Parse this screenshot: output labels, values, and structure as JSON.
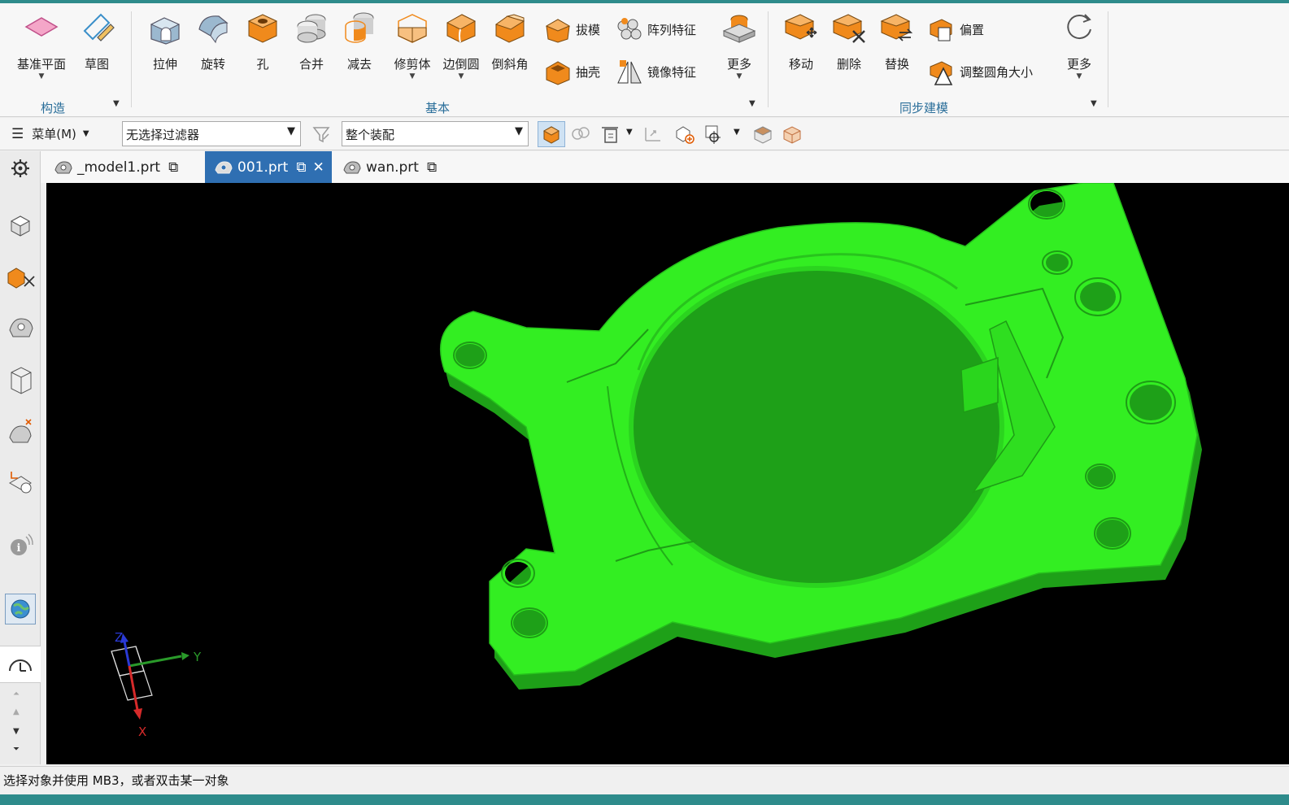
{
  "ribbon": {
    "construct": {
      "group_label": "构造",
      "tools": [
        {
          "label": "基准平面",
          "icon": "datum-plane-icon"
        },
        {
          "label": "草图",
          "icon": "sketch-icon"
        }
      ]
    },
    "basic": {
      "group_label": "基本",
      "tools": [
        {
          "label": "拉伸",
          "icon": "extrude-icon"
        },
        {
          "label": "旋转",
          "icon": "revolve-icon"
        },
        {
          "label": "孔",
          "icon": "hole-icon"
        },
        {
          "label": "合并",
          "icon": "unite-icon"
        },
        {
          "label": "减去",
          "icon": "subtract-icon"
        },
        {
          "label": "修剪体",
          "icon": "trim-body-icon"
        },
        {
          "label": "边倒圆",
          "icon": "edge-blend-icon"
        },
        {
          "label": "倒斜角",
          "icon": "chamfer-icon"
        }
      ],
      "small_tools": [
        {
          "label": "拔模",
          "icon": "draft-icon"
        },
        {
          "label": "抽壳",
          "icon": "shell-icon"
        },
        {
          "label": "阵列特征",
          "icon": "pattern-feature-icon"
        },
        {
          "label": "镜像特征",
          "icon": "mirror-feature-icon"
        }
      ],
      "more_label": "更多"
    },
    "sync": {
      "group_label": "同步建模",
      "tools": [
        {
          "label": "移动",
          "icon": "move-face-icon"
        },
        {
          "label": "删除",
          "icon": "delete-face-icon"
        },
        {
          "label": "替换",
          "icon": "replace-face-icon"
        }
      ],
      "small_tools": [
        {
          "label": "偏置",
          "icon": "offset-region-icon"
        },
        {
          "label": "调整圆角大小",
          "icon": "resize-blend-icon"
        }
      ],
      "more_label": "更多"
    }
  },
  "command_bar": {
    "menu_label": "菜单(M)",
    "selection_filter": "无选择过滤器",
    "selection_scope": "整个装配"
  },
  "tabs": [
    {
      "label": "_model1.prt",
      "active": false
    },
    {
      "label": "001.prt",
      "active": true
    },
    {
      "label": "wan.prt",
      "active": false
    }
  ],
  "triad": {
    "x": "X",
    "y": "Y",
    "z": "Z"
  },
  "status": {
    "text": "选择对象并使用 MB3，或者双击某一对象"
  },
  "colors": {
    "model": "#33ee22",
    "viewport_bg": "#000000",
    "active_tab": "#2f6fb2",
    "feature_orange": "#f08a1c"
  }
}
